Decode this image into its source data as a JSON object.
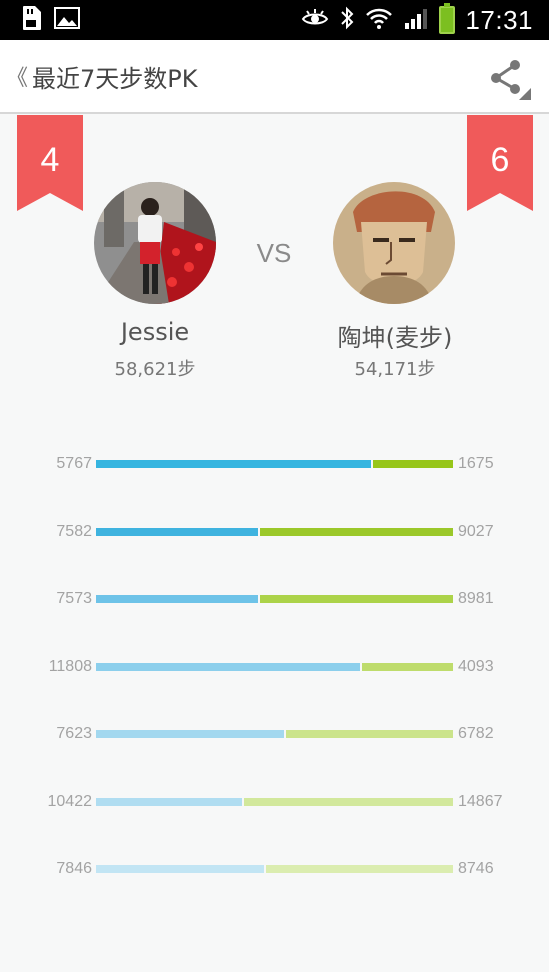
{
  "status_bar": {
    "time": "17:31",
    "left_icons": [
      "sd-card-icon",
      "image-icon"
    ],
    "right_icons": [
      "eye-icon",
      "bluetooth-icon",
      "wifi-icon",
      "signal-icon",
      "battery-icon"
    ]
  },
  "header": {
    "back_glyph": "《",
    "title": "最近7天步数PK",
    "share_icon": "share-icon"
  },
  "left_player": {
    "rank": "4",
    "name": "Jessie",
    "steps": "58,621步"
  },
  "right_player": {
    "rank": "6",
    "name": "陶坤(麦步)",
    "steps": "54,171步"
  },
  "vs_label": "VS",
  "colors": {
    "ribbon": "#f05a5a",
    "left_bar_shades": [
      "#36b5e0",
      "#3fb3df",
      "#6ec3e8",
      "#8ccfec",
      "#a3d8ef",
      "#b0ddf1",
      "#c2e5f4"
    ],
    "right_bar_shades": [
      "#97c61a",
      "#9bc82a",
      "#acd349",
      "#bedc6c",
      "#cbe48b",
      "#d2e89c",
      "#dbedb0"
    ]
  },
  "daily": [
    {
      "left": "5767",
      "right": "1675",
      "left_value": 5767,
      "right_value": 1675
    },
    {
      "left": "7582",
      "right": "9027",
      "left_value": 7582,
      "right_value": 9027
    },
    {
      "left": "7573",
      "right": "8981",
      "left_value": 7573,
      "right_value": 8981
    },
    {
      "left": "11808",
      "right": "4093",
      "left_value": 11808,
      "right_value": 4093
    },
    {
      "left": "7623",
      "right": "6782",
      "left_value": 7623,
      "right_value": 6782
    },
    {
      "left": "10422",
      "right": "14867",
      "left_value": 10422,
      "right_value": 14867
    },
    {
      "left": "7846",
      "right": "8746",
      "left_value": 7846,
      "right_value": 8746
    }
  ]
}
